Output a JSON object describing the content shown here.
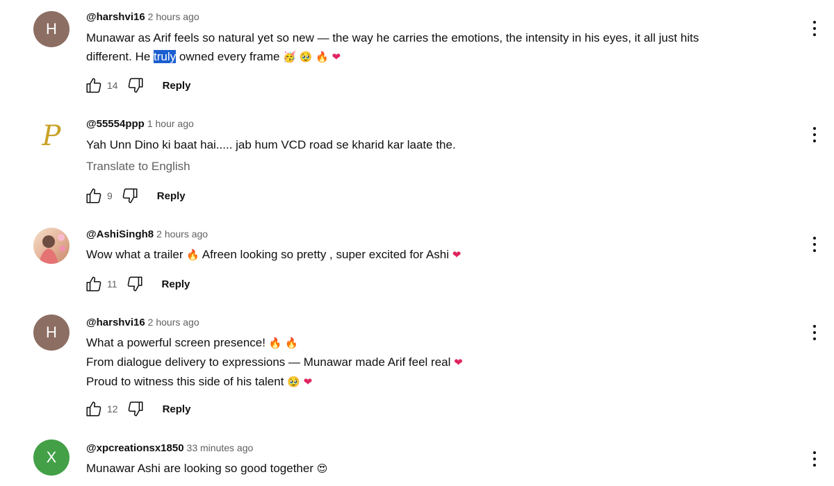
{
  "comments": [
    {
      "avatar_letter": "H",
      "handle": "@harshvi16",
      "time": "2 hours ago",
      "text_before": "Munawar as Arif feels so natural yet so new — the way he carries the emotions, the intensity in his eyes, it all just hits",
      "text_line2_before": "different. He ",
      "text_highlight": "truly",
      "text_line2_after": " owned every frame",
      "likes": "14",
      "reply_label": "Reply"
    },
    {
      "avatar_letter": "P",
      "handle": "@55554ppp",
      "time": "1 hour ago",
      "text": "Yah Unn Dino ki baat hai..... jab hum VCD road se kharid kar laate the.",
      "translate_label": "Translate to English",
      "likes": "9",
      "reply_label": "Reply"
    },
    {
      "handle": "@AshiSingh8",
      "time": "2 hours ago",
      "text_before": "Wow what a trailer",
      "text_after": "Afreen looking so pretty , super excited for Ashi",
      "likes": "11",
      "reply_label": "Reply"
    },
    {
      "avatar_letter": "H",
      "handle": "@harshvi16",
      "time": "2 hours ago",
      "line1": "What a powerful screen presence!",
      "line2": " From dialogue delivery to expressions — Munawar made Arif feel real",
      "line3": "Proud to witness this side of his talent",
      "likes": "12",
      "reply_label": "Reply"
    },
    {
      "avatar_letter": "X",
      "handle": "@xpcreationsx1850",
      "time": "33 minutes ago",
      "text": "Munawar Ashi are looking so good together"
    }
  ],
  "icons": {
    "like": "thumbs-up-icon",
    "dislike": "thumbs-down-icon",
    "more": "more-vert-icon",
    "fire": "fire-emoji",
    "heart": "heart-emoji",
    "face": "face-emoji"
  },
  "colors": {
    "avatar_brown": "#8d6e63",
    "avatar_green": "#43a047",
    "highlight": "#1a5fd0"
  }
}
